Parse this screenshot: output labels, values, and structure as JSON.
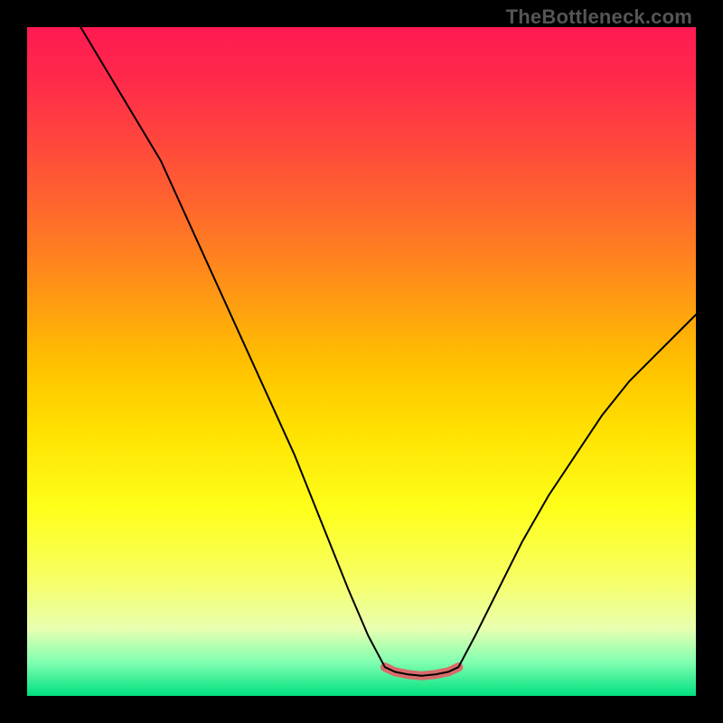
{
  "watermark": "TheBottleneck.com",
  "chart_data": {
    "type": "line",
    "title": "",
    "xlabel": "",
    "ylabel": "",
    "xlim": [
      0,
      100
    ],
    "ylim": [
      0,
      100
    ],
    "categories": [],
    "series": [
      {
        "name": "black-curve",
        "color": "#000000",
        "width": 2,
        "points": [
          [
            8,
            100
          ],
          [
            14,
            90
          ],
          [
            20,
            80
          ],
          [
            25,
            69
          ],
          [
            30,
            58
          ],
          [
            35,
            47
          ],
          [
            40,
            36
          ],
          [
            44,
            26
          ],
          [
            48,
            16
          ],
          [
            51,
            9
          ],
          [
            53.5,
            4.3
          ],
          [
            55,
            3.6
          ],
          [
            57,
            3.2
          ],
          [
            59,
            3.0
          ],
          [
            61,
            3.2
          ],
          [
            63,
            3.6
          ],
          [
            64.5,
            4.3
          ],
          [
            67,
            9
          ],
          [
            70,
            15
          ],
          [
            74,
            23
          ],
          [
            78,
            30
          ],
          [
            82,
            36
          ],
          [
            86,
            42
          ],
          [
            90,
            47
          ],
          [
            94,
            51
          ],
          [
            98,
            55
          ],
          [
            100,
            57
          ]
        ]
      },
      {
        "name": "pink-floor-band",
        "color": "#d96b6b",
        "width": 10,
        "points": [
          [
            53.5,
            4.3
          ],
          [
            55,
            3.6
          ],
          [
            57,
            3.2
          ],
          [
            59,
            3.0
          ],
          [
            61,
            3.2
          ],
          [
            63,
            3.6
          ],
          [
            64.5,
            4.3
          ]
        ]
      }
    ],
    "background_gradient": {
      "stops": [
        {
          "pos": 0,
          "color": "#ff1a52"
        },
        {
          "pos": 50,
          "color": "#ffc000"
        },
        {
          "pos": 72,
          "color": "#feff1a"
        },
        {
          "pos": 95,
          "color": "#80ffb0"
        },
        {
          "pos": 100,
          "color": "#00e080"
        }
      ]
    }
  }
}
